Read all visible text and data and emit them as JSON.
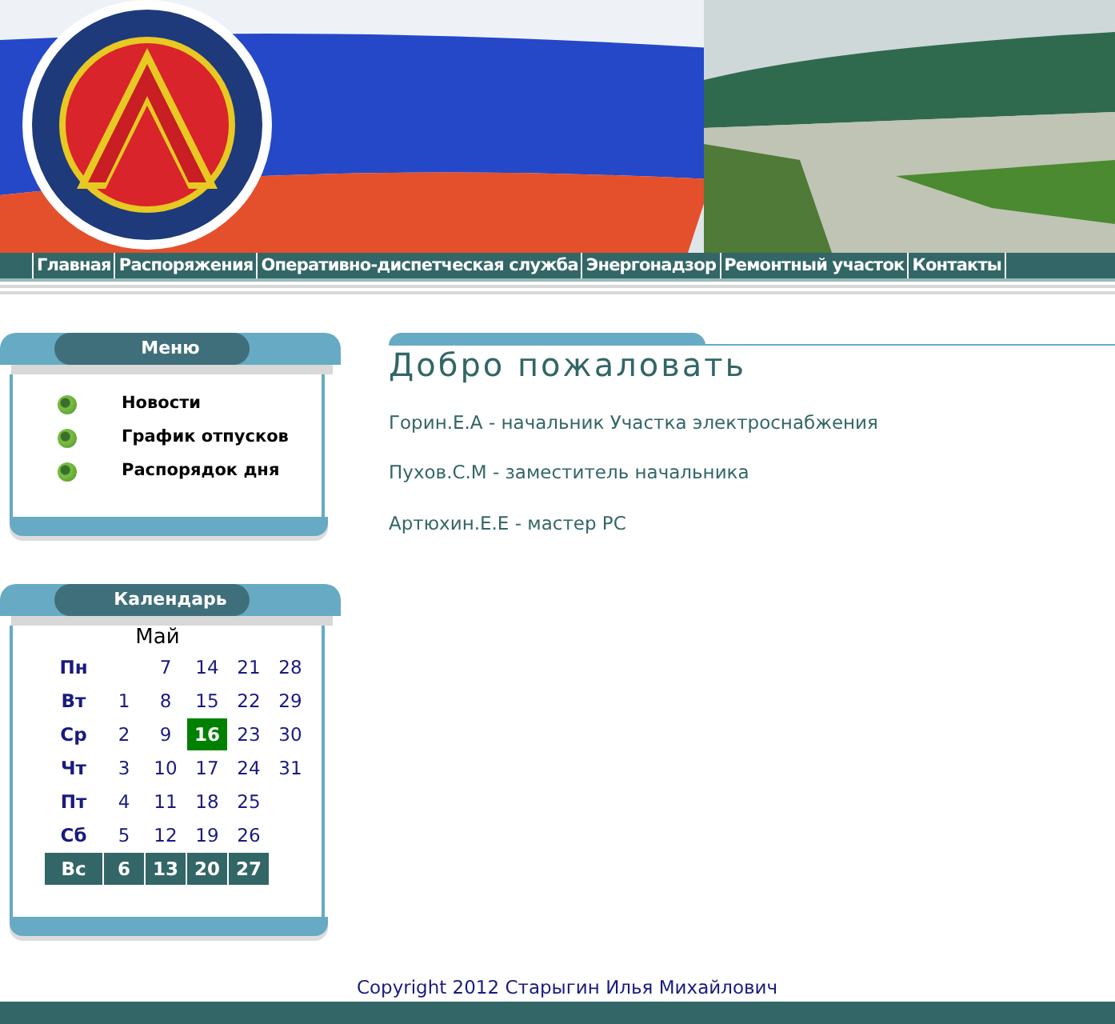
{
  "nav": [
    {
      "label": "Главная"
    },
    {
      "label": "Распоряжения"
    },
    {
      "label": "Оперативно-диспетческая служба"
    },
    {
      "label": "Энергонадзор"
    },
    {
      "label": "Ремонтный участок"
    },
    {
      "label": "Контакты"
    }
  ],
  "menu": {
    "title": "Меню",
    "items": [
      "Новости",
      "График отпусков",
      "Распорядок дня"
    ]
  },
  "calendar": {
    "title": "Календарь",
    "month": "Май",
    "rows": [
      {
        "day": "Пн",
        "kind": "weekday",
        "leading_blank": true,
        "dates": [
          {
            "d": "7",
            "selected": false
          },
          {
            "d": "14",
            "selected": false
          },
          {
            "d": "21",
            "selected": false
          },
          {
            "d": "28",
            "selected": false
          }
        ]
      },
      {
        "day": "Вт",
        "kind": "weekday",
        "dates": [
          {
            "d": "1",
            "selected": false
          },
          {
            "d": "8",
            "selected": false
          },
          {
            "d": "15",
            "selected": false
          },
          {
            "d": "22",
            "selected": false
          },
          {
            "d": "29",
            "selected": false
          }
        ]
      },
      {
        "day": "Ср",
        "kind": "weekday",
        "dates": [
          {
            "d": "2",
            "selected": false
          },
          {
            "d": "9",
            "selected": false
          },
          {
            "d": "16",
            "selected": true
          },
          {
            "d": "23",
            "selected": false
          },
          {
            "d": "30",
            "selected": false
          }
        ]
      },
      {
        "day": "Чт",
        "kind": "weekday",
        "dates": [
          {
            "d": "3",
            "selected": false
          },
          {
            "d": "10",
            "selected": false
          },
          {
            "d": "17",
            "selected": false
          },
          {
            "d": "24",
            "selected": false
          },
          {
            "d": "31",
            "selected": false
          }
        ]
      },
      {
        "day": "Пт",
        "kind": "weekday",
        "dates": [
          {
            "d": "4",
            "selected": false
          },
          {
            "d": "11",
            "selected": false
          },
          {
            "d": "18",
            "selected": false
          },
          {
            "d": "25",
            "selected": false
          }
        ]
      },
      {
        "day": "Сб",
        "kind": "weekday",
        "dates": [
          {
            "d": "5",
            "selected": false
          },
          {
            "d": "12",
            "selected": false
          },
          {
            "d": "19",
            "selected": false
          },
          {
            "d": "26",
            "selected": false
          }
        ]
      },
      {
        "day": "Вс",
        "kind": "weekend",
        "dates": [
          {
            "d": "6",
            "selected": false
          },
          {
            "d": "13",
            "selected": false
          },
          {
            "d": "20",
            "selected": false
          },
          {
            "d": "27",
            "selected": false
          }
        ]
      }
    ]
  },
  "content": {
    "heading": "Добро пожаловать",
    "lines": [
      "Горин.Е.А - начальник Участка электроснабжения",
      "Пухов.С.М - заместитель начальника",
      "Артюхин.Е.Е - мастер РС"
    ]
  },
  "footer": {
    "copyright": "Copyright 2012 Старыгин Илья Михайлович"
  }
}
